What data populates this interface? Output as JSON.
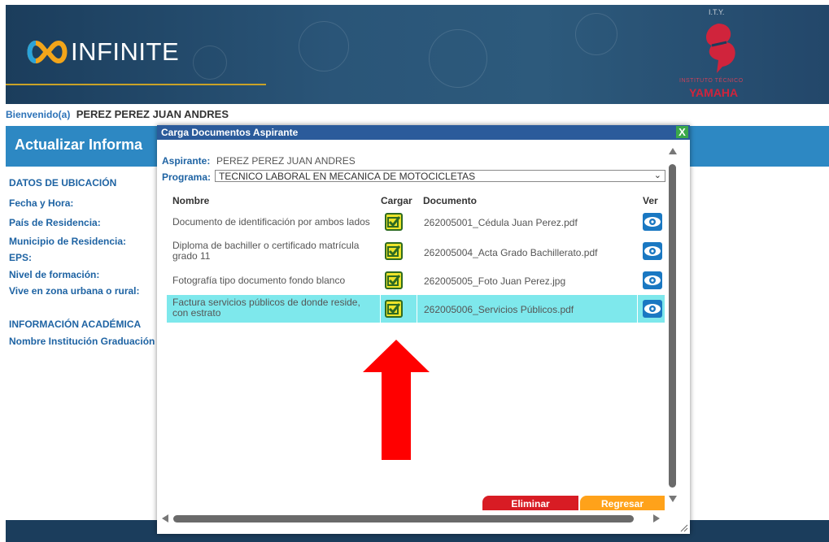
{
  "header": {
    "logo_text": "INFINITE",
    "partner_logo_top": "I.T.Y.",
    "partner_logo_sub": "INSTITUTO TÉCNICO",
    "partner_logo_brand": "YAMAHA"
  },
  "welcome": {
    "label": "Bienvenido(a)",
    "name": "PEREZ PEREZ JUAN ANDRES"
  },
  "page": {
    "title": "Actualizar Informa"
  },
  "left_panel": {
    "section1": "DATOS DE UBICACIÓN",
    "fields": [
      "Fecha y Hora:",
      "País de Residencia:",
      "Municipio de Residencia:",
      "EPS:",
      "Nivel de formación:",
      "Vive en zona urbana o rural:"
    ],
    "section2": "INFORMACIÓN ACADÉMICA",
    "field_institution": "Nombre Institución Graduación"
  },
  "dialog": {
    "title": "Carga Documentos Aspirante",
    "close_label": "X",
    "aspirante_label": "Aspirante:",
    "aspirante_value": "PEREZ PEREZ JUAN ANDRES",
    "programa_label": "Programa:",
    "programa_value": "TECNICO LABORAL EN MECANICA DE MOTOCICLETAS",
    "columns": {
      "nombre": "Nombre",
      "cargar": "Cargar",
      "documento": "Documento",
      "ver": "Ver"
    },
    "rows": [
      {
        "name": "Documento de identificación por ambos lados",
        "doc": "262005001_Cédula Juan Perez.pdf"
      },
      {
        "name": "Diploma de bachiller o certificado matrícula grado 11",
        "doc": "262005004_Acta Grado Bachillerato.pdf"
      },
      {
        "name": "Fotografía tipo documento fondo blanco",
        "doc": "262005005_Foto Juan Perez.jpg"
      },
      {
        "name": "Factura servicios públicos de donde reside, con estrato",
        "doc": "262005006_Servicios Públicos.pdf"
      }
    ],
    "btn_delete": "Eliminar",
    "btn_back": "Regresar"
  },
  "colors": {
    "header_bg": "#1b3d5c",
    "blue_bar": "#2d88c3",
    "dialog_title_bg": "#2b5b9b",
    "highlight_row": "#7ee8ec",
    "arrow": "#ff0000",
    "delete_btn": "#d81c24",
    "back_btn": "#ffa21a"
  }
}
